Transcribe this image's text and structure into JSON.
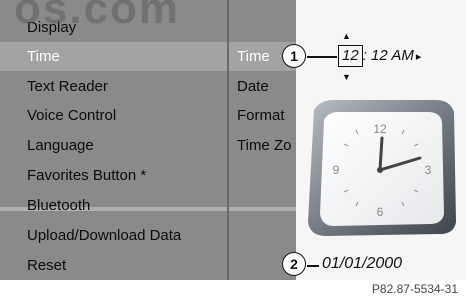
{
  "watermark": "os.com",
  "settings_menu": {
    "items": [
      {
        "label": "Display"
      },
      {
        "label": "Time",
        "selected": true
      },
      {
        "label": "Text Reader"
      },
      {
        "label": "Voice Control"
      },
      {
        "label": "Language"
      },
      {
        "label": "Favorites Button *"
      },
      {
        "label": "Bluetooth"
      },
      {
        "label": "Upload/Download Data"
      },
      {
        "label": "Reset"
      }
    ]
  },
  "time_submenu": {
    "items": [
      {
        "label": "Time",
        "selected": true
      },
      {
        "label": "Date"
      },
      {
        "label": "Format"
      },
      {
        "label": "Time Zo"
      }
    ]
  },
  "time_setting": {
    "callout": "1",
    "hour": "12",
    "rest": ": 12 AM",
    "next_glyph": "▸",
    "up_glyph": "▲",
    "down_glyph": "▼"
  },
  "clock_face": {
    "numerals": [
      "12",
      "3",
      "6",
      "9"
    ],
    "icon": "analog-clock-icon"
  },
  "date_setting": {
    "callout": "2",
    "value": "01/01/2000"
  },
  "figure_code": "P82.87-5534-31",
  "colors": {
    "screen_bg": "#8a8a8a",
    "selected_bg": "#a3a3a3",
    "panel_bg": "#f6f6f6"
  }
}
